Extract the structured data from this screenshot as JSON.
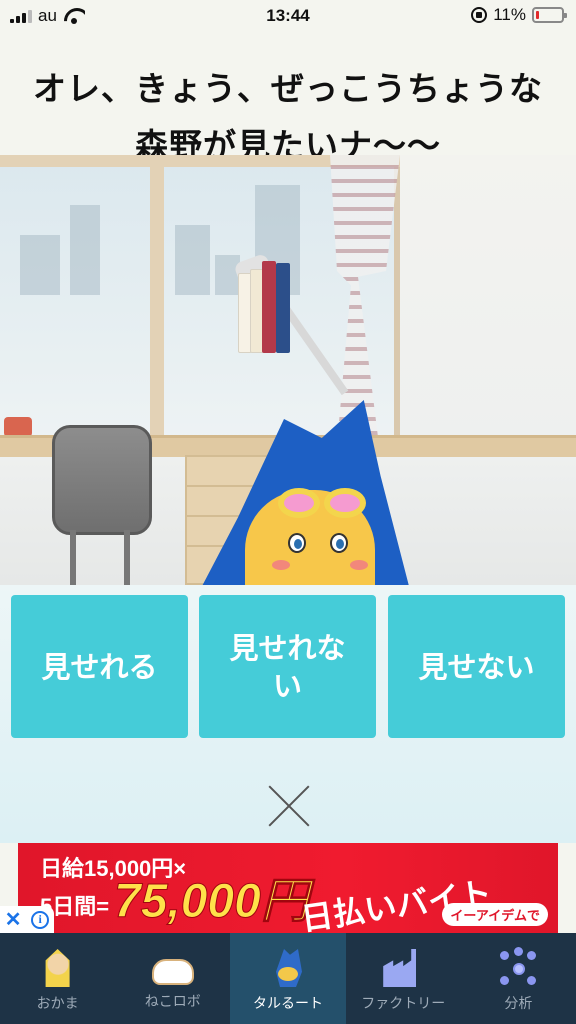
{
  "status_bar": {
    "carrier": "au",
    "time": "13:44",
    "battery_percent": "11%",
    "battery_level": 0.11
  },
  "question": {
    "text": "オレ、きょう、ぜっこうちょうな森野が見たいナ〜〜"
  },
  "answers": [
    {
      "label": "見せれる"
    },
    {
      "label": "見せれない"
    },
    {
      "label": "見せない"
    }
  ],
  "ad": {
    "line1": "日給15,000円×",
    "line2": "5日間=",
    "amount": "75,000円",
    "headline": "日払いバイト",
    "company": "イーアイデムで"
  },
  "bottom_nav": {
    "items": [
      {
        "label": "おかま"
      },
      {
        "label": "ねこロボ"
      },
      {
        "label": "タルるート"
      },
      {
        "label": "ファクトリー"
      },
      {
        "label": "分析"
      }
    ],
    "active_index": 2
  },
  "colors": {
    "answer_button": "#45ccd8",
    "nav_background": "#1e3346",
    "nav_active": "#24506b",
    "ad_background": "#e0162a"
  }
}
